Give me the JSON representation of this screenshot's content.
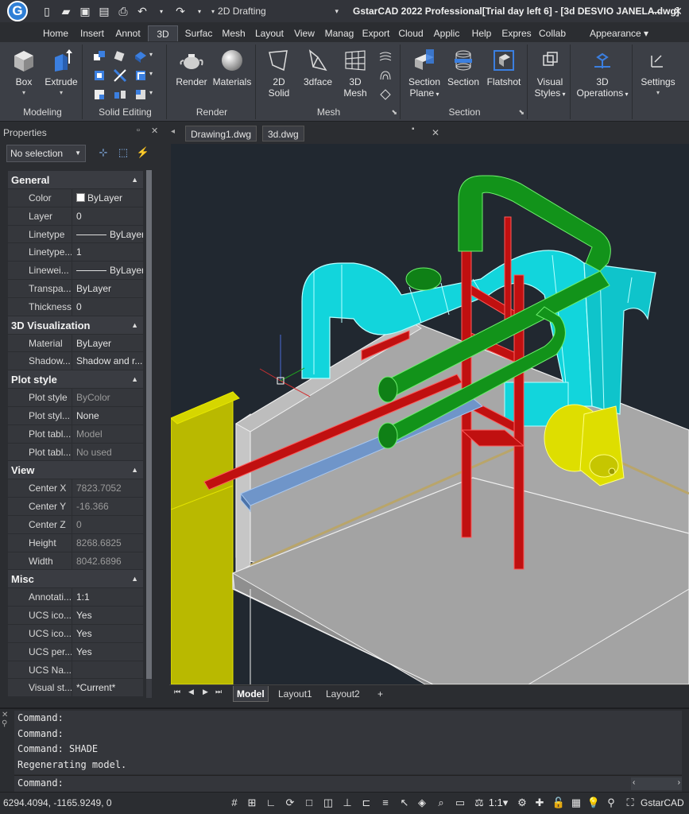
{
  "titlebar": {
    "logo_letter": "G",
    "workspace": "2D Drafting",
    "title": "GstarCAD 2022 Professional[Trial day left 6] - [3d DESVIO JANELA.dwg]",
    "quick_access_icons": [
      "new-icon",
      "open-icon",
      "save-icon",
      "saveas-icon",
      "print-icon",
      "undo-icon",
      "redo-icon"
    ]
  },
  "ribbon": {
    "tabs": [
      "Home",
      "Insert",
      "Annot",
      "3D",
      "Surfac",
      "Mesh",
      "Layout",
      "View",
      "Manag",
      "Export",
      "Cloud",
      "Applic",
      "Help",
      "Expres",
      "Collab"
    ],
    "active_tab": "3D",
    "appearance": "Appearance",
    "panels": {
      "modeling": {
        "title": "Modeling",
        "box": "Box",
        "extrude": "Extrude"
      },
      "solid_editing": {
        "title": "Solid Editing"
      },
      "render": {
        "title": "Render",
        "render": "Render",
        "materials": "Materials"
      },
      "mesh": {
        "title": "Mesh",
        "solid2d": "2D\nSolid",
        "solid2d_a": "2D",
        "solid2d_b": "Solid",
        "face3d": "3dface",
        "mesh3d_a": "3D",
        "mesh3d_b": "Mesh"
      },
      "section": {
        "title": "Section",
        "plane_a": "Section",
        "plane_b": "Plane",
        "section": "Section",
        "flatshot": "Flatshot"
      },
      "visual_styles": {
        "a": "Visual",
        "b": "Styles"
      },
      "operations_3d": {
        "a": "3D",
        "b": "Operations"
      },
      "settings": {
        "label": "Settings"
      }
    }
  },
  "properties": {
    "header": "Properties",
    "selection": "No selection",
    "sections": [
      {
        "title": "General",
        "rows": [
          {
            "k": "Color",
            "v": "ByLayer",
            "type": "color"
          },
          {
            "k": "Layer",
            "v": "0"
          },
          {
            "k": "Linetype",
            "v": "ByLayer",
            "type": "line"
          },
          {
            "k": "Linetype...",
            "v": "1"
          },
          {
            "k": "Linewei...",
            "v": "ByLayer",
            "type": "line"
          },
          {
            "k": "Transpa...",
            "v": "ByLayer"
          },
          {
            "k": "Thickness",
            "v": "0"
          }
        ]
      },
      {
        "title": "3D Visualization",
        "rows": [
          {
            "k": "Material",
            "v": "ByLayer"
          },
          {
            "k": "Shadow...",
            "v": "Shadow and r..."
          }
        ]
      },
      {
        "title": "Plot style",
        "rows": [
          {
            "k": "Plot style",
            "v": "ByColor",
            "dim": true
          },
          {
            "k": "Plot styl...",
            "v": "None"
          },
          {
            "k": "Plot tabl...",
            "v": "Model",
            "dim": true
          },
          {
            "k": "Plot tabl...",
            "v": "No used",
            "dim": true
          }
        ]
      },
      {
        "title": "View",
        "rows": [
          {
            "k": "Center X",
            "v": "7823.7052",
            "dim": true
          },
          {
            "k": "Center Y",
            "v": "-16.366",
            "dim": true
          },
          {
            "k": "Center Z",
            "v": "0",
            "dim": true
          },
          {
            "k": "Height",
            "v": "8268.6825",
            "dim": true
          },
          {
            "k": "Width",
            "v": "8042.6896",
            "dim": true
          }
        ]
      },
      {
        "title": "Misc",
        "rows": [
          {
            "k": "Annotati...",
            "v": "1:1"
          },
          {
            "k": "UCS ico...",
            "v": "Yes"
          },
          {
            "k": "UCS ico...",
            "v": "Yes"
          },
          {
            "k": "UCS per...",
            "v": "Yes"
          },
          {
            "k": "UCS Na...",
            "v": ""
          },
          {
            "k": "Visual st...",
            "v": "*Current*"
          }
        ]
      }
    ]
  },
  "documents": {
    "tabs": [
      "Drawing1.dwg",
      "3d.dwg"
    ],
    "layout_tabs": [
      "Model",
      "Layout1",
      "Layout2",
      "+"
    ]
  },
  "command": {
    "history": [
      "Command:",
      "Command:",
      "Command: SHADE",
      "Regenerating model."
    ],
    "prompt": "Command:"
  },
  "status": {
    "coords": "6294.4094, -1165.9249, 0",
    "scale": "1:1",
    "brand": "GstarCAD"
  },
  "colors": {
    "cyan_duct": "#1fe0e6",
    "green_pipe": "#14a01c",
    "red_frame": "#c41414",
    "yellow": "#cfcf00",
    "gray_solid": "#a9a9a9"
  }
}
